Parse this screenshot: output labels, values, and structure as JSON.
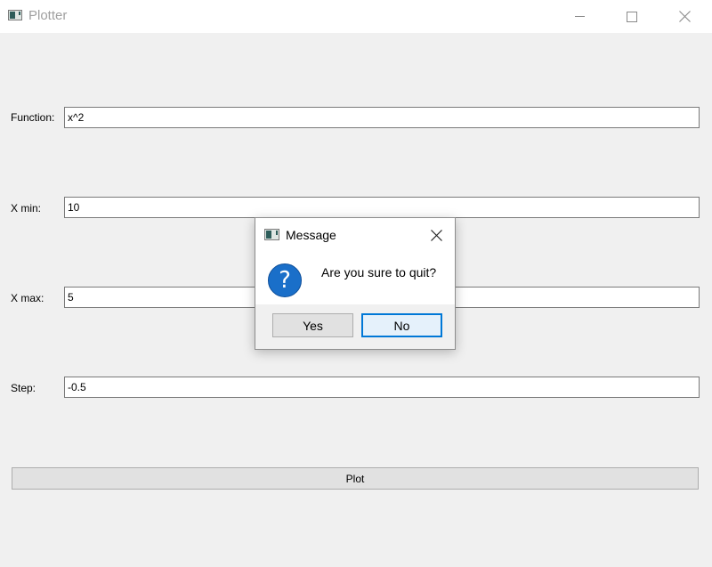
{
  "window": {
    "title": "Plotter",
    "icons": {
      "app": "app-window-icon",
      "minimize": "minimize-icon",
      "maximize": "maximize-icon",
      "close": "close-icon"
    }
  },
  "form": {
    "function": {
      "label": "Function:",
      "value": "x^2"
    },
    "xmin": {
      "label": "X min:",
      "value": "10"
    },
    "xmax": {
      "label": "X max:",
      "value": "5"
    },
    "step": {
      "label": "Step:",
      "value": "-0.5"
    },
    "plot_button": "Plot"
  },
  "dialog": {
    "title": "Message",
    "message": "Are you sure to quit?",
    "icon": "question-icon",
    "yes_label": "Yes",
    "no_label": "No",
    "accent": "#0078d7",
    "icon_color": "#1a6fc9"
  }
}
